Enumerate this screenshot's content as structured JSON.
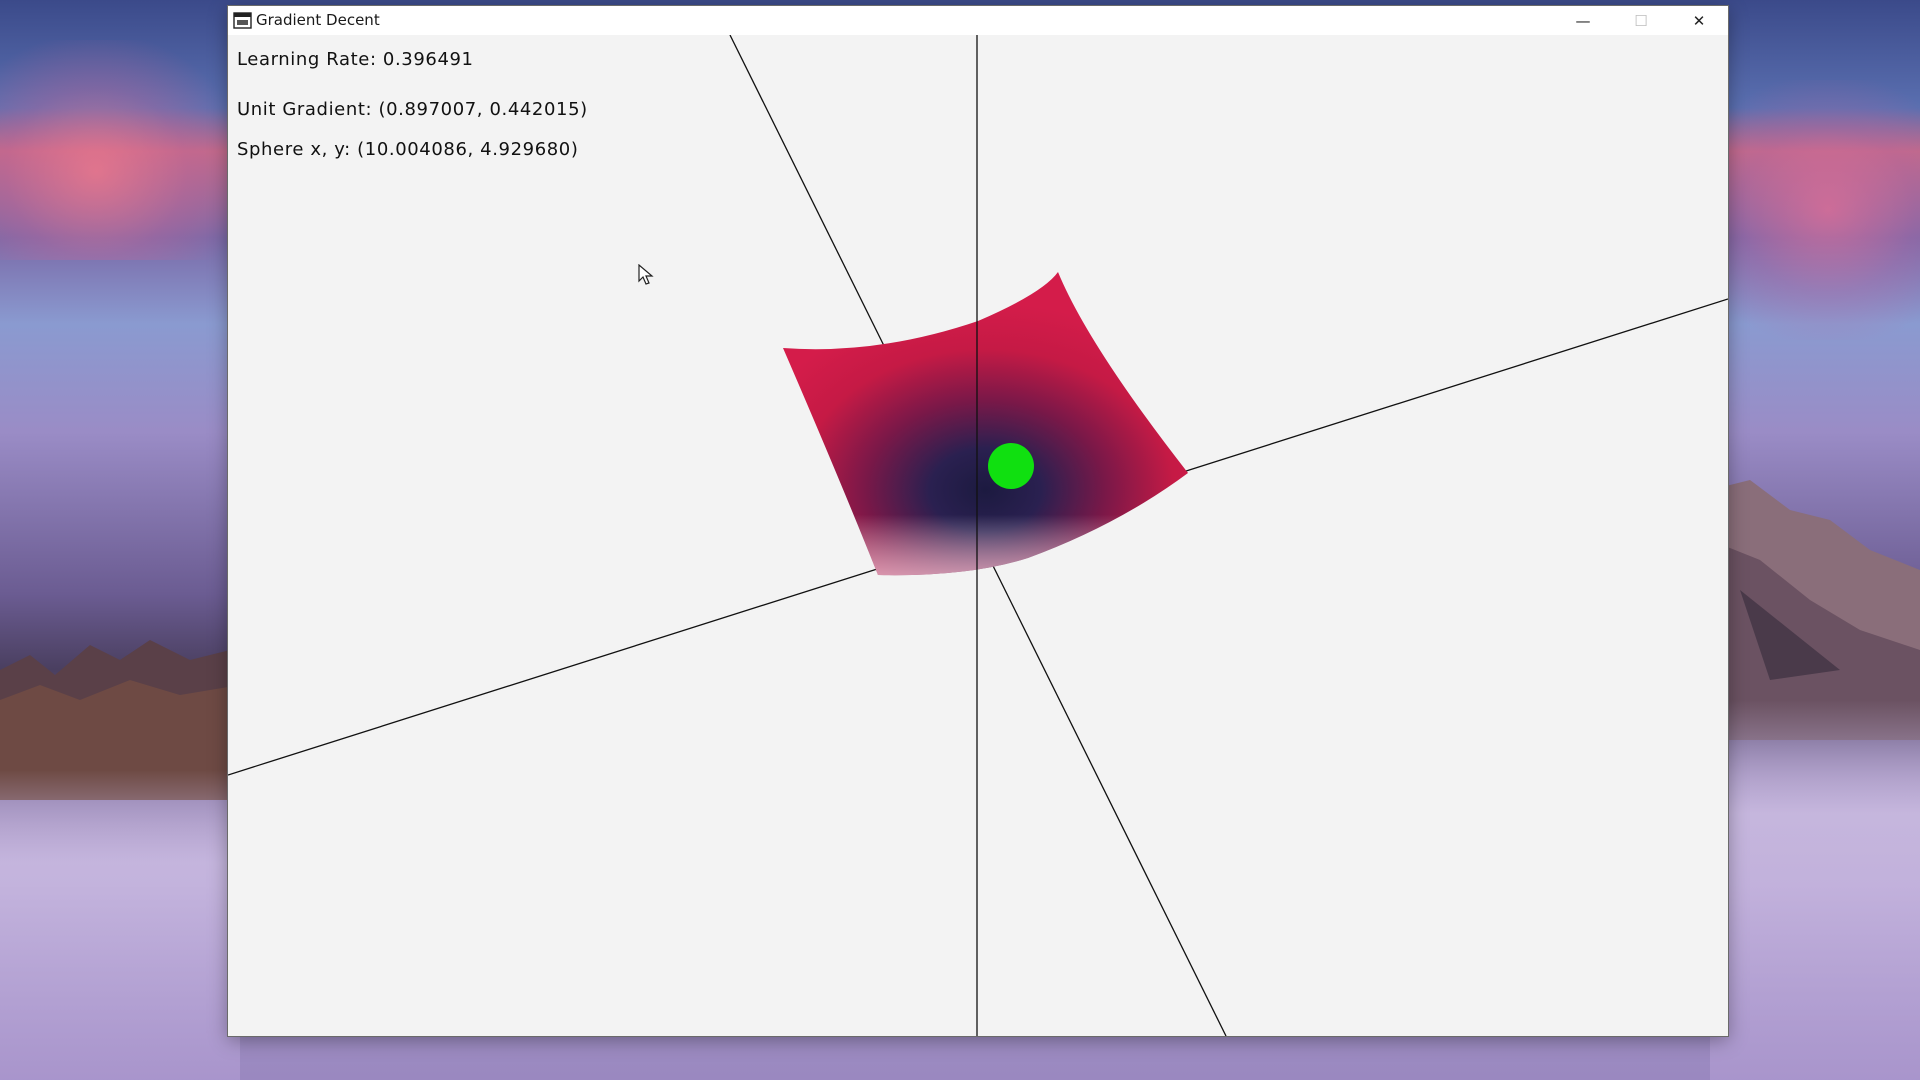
{
  "window": {
    "title": "Gradient Decent",
    "controls": {
      "minimize": "—",
      "maximize": "☐",
      "close": "✕"
    }
  },
  "hud": {
    "learning_rate": "Learning Rate: 0.396491",
    "unit_gradient": "Unit Gradient: (0.897007, 0.442015)",
    "sphere_xy": "Sphere x, y: (10.004086, 4.929680)"
  },
  "scene": {
    "surface_color": "#cc1a44",
    "surface_dark_color": "#1c1a40",
    "sphere_color": "#10e010",
    "axis_color": "#111111"
  },
  "icons": [
    "app-icon",
    "minimize-icon",
    "maximize-icon",
    "close-icon",
    "mouse-cursor-icon"
  ]
}
